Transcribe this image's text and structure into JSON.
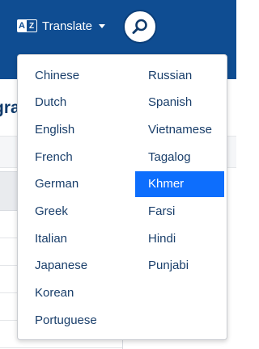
{
  "header": {
    "translate_label": "Translate",
    "translate_icon": "a-z-translate-icon",
    "search_icon": "search-icon"
  },
  "page": {
    "heading_fragment": "gra"
  },
  "menu": {
    "selected": "Khmer",
    "left_column": [
      "Chinese",
      "Dutch",
      "English",
      "French",
      "German",
      "Greek",
      "Italian",
      "Japanese",
      "Korean",
      "Portuguese"
    ],
    "right_column": [
      "Russian",
      "Spanish",
      "Vietnamese",
      "Tagalog",
      "Khmer",
      "Farsi",
      "Hindi",
      "Punjabi"
    ]
  },
  "colors": {
    "header_bg": "#0f4d92",
    "selected_bg": "#0d6efd",
    "item_text": "#1a3f6b"
  }
}
